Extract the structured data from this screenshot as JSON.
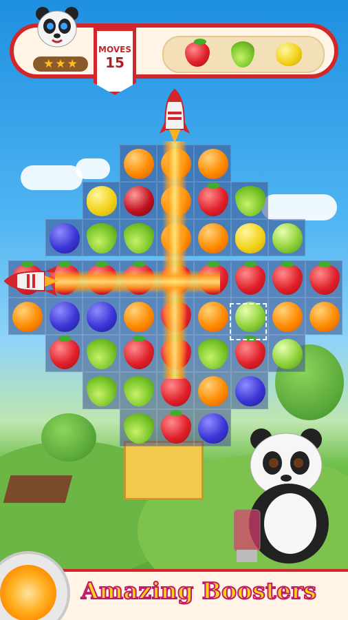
{
  "hud": {
    "moves_label": "MOVES",
    "moves_value": "15",
    "stars_earned": 3,
    "goal_items": [
      "strawberry-icon",
      "pear-icon",
      "lemon-icon"
    ]
  },
  "board": {
    "cells": [
      {
        "r": 0,
        "c": 3,
        "fruit": "orange"
      },
      {
        "r": 0,
        "c": 4,
        "fruit": "orange"
      },
      {
        "r": 0,
        "c": 5,
        "fruit": "orange"
      },
      {
        "r": 1,
        "c": 2,
        "fruit": "lemon"
      },
      {
        "r": 1,
        "c": 3,
        "fruit": "redapple"
      },
      {
        "r": 1,
        "c": 4,
        "fruit": "orange"
      },
      {
        "r": 1,
        "c": 5,
        "fruit": "strawberry"
      },
      {
        "r": 1,
        "c": 6,
        "fruit": "pear"
      },
      {
        "r": 2,
        "c": 1,
        "fruit": "blueberry"
      },
      {
        "r": 2,
        "c": 2,
        "fruit": "pear"
      },
      {
        "r": 2,
        "c": 3,
        "fruit": "pear"
      },
      {
        "r": 2,
        "c": 4,
        "fruit": "orange"
      },
      {
        "r": 2,
        "c": 5,
        "fruit": "orange"
      },
      {
        "r": 2,
        "c": 6,
        "fruit": "lemon"
      },
      {
        "r": 2,
        "c": 7,
        "fruit": "apple"
      },
      {
        "r": 3,
        "c": 0,
        "fruit": "strawberry"
      },
      {
        "r": 3,
        "c": 1,
        "fruit": "strawberry"
      },
      {
        "r": 3,
        "c": 2,
        "fruit": "strawberry"
      },
      {
        "r": 3,
        "c": 3,
        "fruit": "strawberry"
      },
      {
        "r": 3,
        "c": 4,
        "fruit": "strawberry"
      },
      {
        "r": 3,
        "c": 5,
        "fruit": "strawberry"
      },
      {
        "r": 3,
        "c": 6,
        "fruit": "strawberry"
      },
      {
        "r": 3,
        "c": 7,
        "fruit": "strawberry"
      },
      {
        "r": 3,
        "c": 8,
        "fruit": "strawberry"
      },
      {
        "r": 4,
        "c": 0,
        "fruit": "orange"
      },
      {
        "r": 4,
        "c": 1,
        "fruit": "blueberry"
      },
      {
        "r": 4,
        "c": 2,
        "fruit": "blueberry"
      },
      {
        "r": 4,
        "c": 3,
        "fruit": "orange"
      },
      {
        "r": 4,
        "c": 4,
        "fruit": "strawberry"
      },
      {
        "r": 4,
        "c": 5,
        "fruit": "orange"
      },
      {
        "r": 4,
        "c": 6,
        "fruit": "apple"
      },
      {
        "r": 4,
        "c": 7,
        "fruit": "orange"
      },
      {
        "r": 4,
        "c": 8,
        "fruit": "orange"
      },
      {
        "r": 5,
        "c": 1,
        "fruit": "strawberry"
      },
      {
        "r": 5,
        "c": 2,
        "fruit": "pear"
      },
      {
        "r": 5,
        "c": 3,
        "fruit": "strawberry"
      },
      {
        "r": 5,
        "c": 4,
        "fruit": "strawberry"
      },
      {
        "r": 5,
        "c": 5,
        "fruit": "pear"
      },
      {
        "r": 5,
        "c": 6,
        "fruit": "strawberry"
      },
      {
        "r": 5,
        "c": 7,
        "fruit": "apple"
      },
      {
        "r": 6,
        "c": 2,
        "fruit": "pear"
      },
      {
        "r": 6,
        "c": 3,
        "fruit": "pear"
      },
      {
        "r": 6,
        "c": 4,
        "fruit": "strawberry"
      },
      {
        "r": 6,
        "c": 5,
        "fruit": "orange"
      },
      {
        "r": 6,
        "c": 6,
        "fruit": "blueberry"
      },
      {
        "r": 7,
        "c": 3,
        "fruit": "pear"
      },
      {
        "r": 7,
        "c": 4,
        "fruit": "strawberry"
      },
      {
        "r": 7,
        "c": 5,
        "fruit": "blueberry"
      }
    ]
  },
  "footer": {
    "banner_text": "Amazing Boosters"
  }
}
